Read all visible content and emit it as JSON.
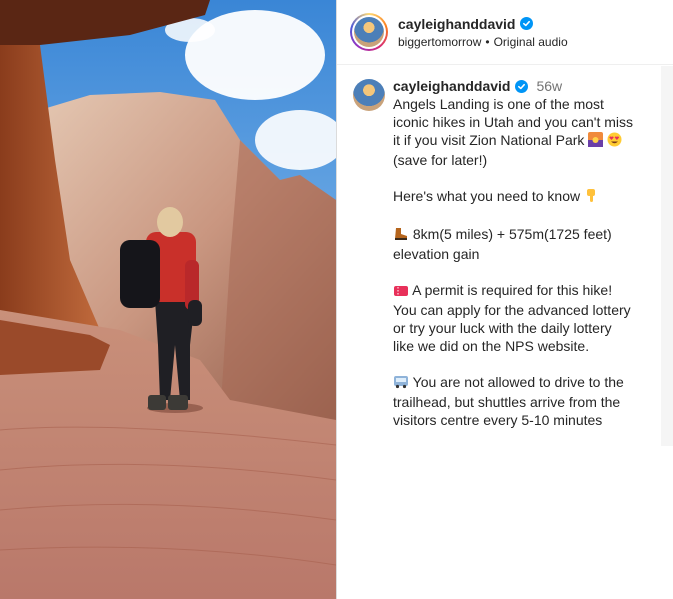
{
  "post": {
    "username": "cayleighanddavid",
    "audio_account": "biggertomorrow",
    "audio_separator": "•",
    "audio_label": "Original audio",
    "verified": true
  },
  "caption": {
    "username": "cayleighanddavid",
    "time": "56w",
    "lines": [
      "Angels Landing is one of the most",
      "iconic hikes in Utah and you can't miss",
      "it if you visit Zion National Park",
      "(save for later!)",
      "",
      "Here's what you need to know",
      "",
      "8km(5 miles) + 575m(1725 feet)",
      "elevation gain",
      "",
      "A permit is required for this hike!",
      "You can apply for the advanced lottery",
      "or try your luck with the daily lottery",
      "like we did on the NPS website.",
      "",
      "You are not allowed to drive to the",
      "trailhead, but shuttles arrive from the",
      "visitors centre every 5-10 minutes"
    ]
  },
  "icons": {
    "verified": "verified-badge-icon",
    "landscape_emoji": "sunset-landscape-emoji",
    "heart_eyes_emoji": "heart-eyes-emoji",
    "pointing_down_emoji": "backhand-index-down-emoji",
    "boot_emoji": "hiking-boot-emoji",
    "ticket_emoji": "ticket-emoji",
    "bus_emoji": "bus-emoji"
  },
  "colors": {
    "verified_blue": "#0095f6",
    "secondary_text": "#737373"
  }
}
